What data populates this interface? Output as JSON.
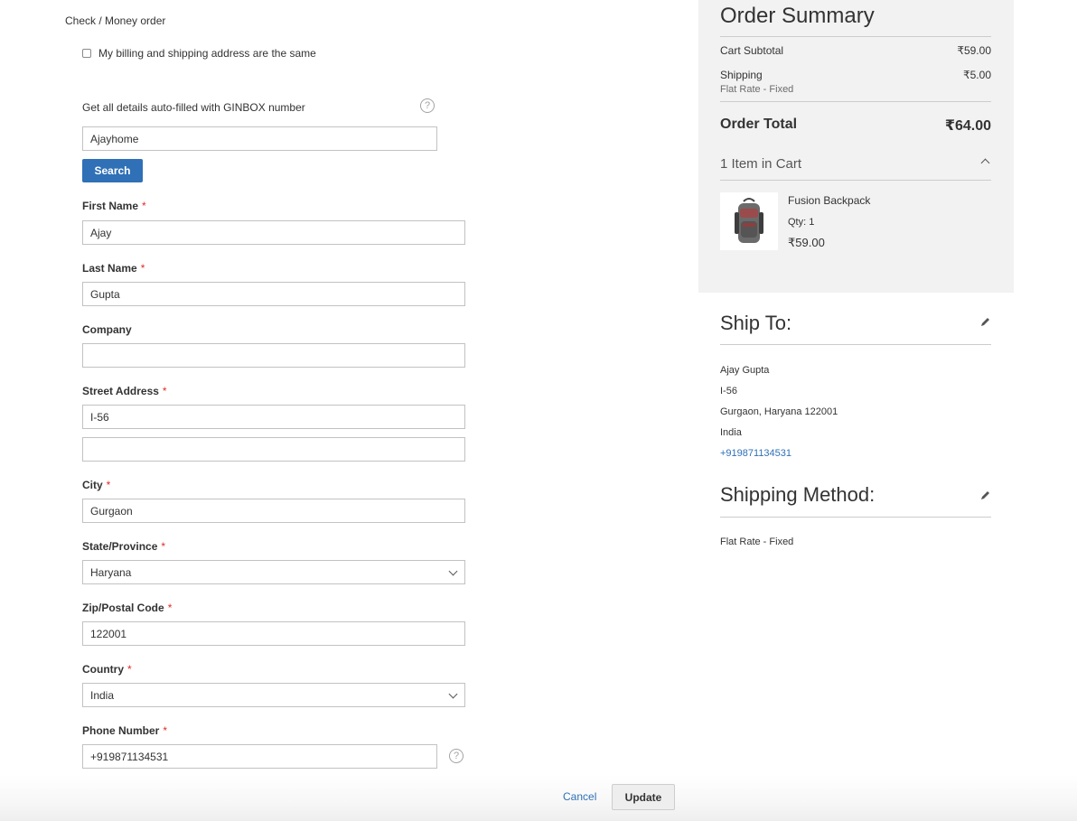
{
  "payment": {
    "method_title": "Check / Money order",
    "same_address_label": "My billing and shipping address are the same"
  },
  "ginbox": {
    "label": "Get all details auto-filled with GINBOX number",
    "value": "Ajayhome",
    "search_label": "Search"
  },
  "form": {
    "first_name": {
      "label": "First Name",
      "value": "Ajay"
    },
    "last_name": {
      "label": "Last Name",
      "value": "Gupta"
    },
    "company": {
      "label": "Company",
      "value": ""
    },
    "street": {
      "label": "Street Address",
      "line1": "I-56",
      "line2": ""
    },
    "city": {
      "label": "City",
      "value": "Gurgaon"
    },
    "state": {
      "label": "State/Province",
      "value": "Haryana"
    },
    "zip": {
      "label": "Zip/Postal Code",
      "value": "122001"
    },
    "country": {
      "label": "Country",
      "value": "India"
    },
    "phone": {
      "label": "Phone Number",
      "value": "+919871134531"
    },
    "required_mark": "*"
  },
  "actions": {
    "cancel_label": "Cancel",
    "update_label": "Update"
  },
  "summary": {
    "title": "Order Summary",
    "subtotal_label": "Cart Subtotal",
    "subtotal_value": "₹59.00",
    "shipping_label": "Shipping",
    "shipping_value": "₹5.00",
    "shipping_method": "Flat Rate - Fixed",
    "total_label": "Order Total",
    "total_value": "₹64.00",
    "items_title": "1 Item in Cart",
    "product": {
      "name": "Fusion Backpack",
      "qty": "Qty: 1",
      "price": "₹59.00"
    }
  },
  "ship_to": {
    "title": "Ship To:",
    "name": "Ajay Gupta",
    "street": "I-56",
    "city_line": "Gurgaon, Haryana 122001",
    "country": "India",
    "phone": "+919871134531"
  },
  "shipping_method": {
    "title": "Shipping Method:",
    "value": "Flat Rate - Fixed"
  },
  "colors": {
    "link": "#2f70b7",
    "required": "#e02b27",
    "summary_bg": "#f2f2f2"
  }
}
